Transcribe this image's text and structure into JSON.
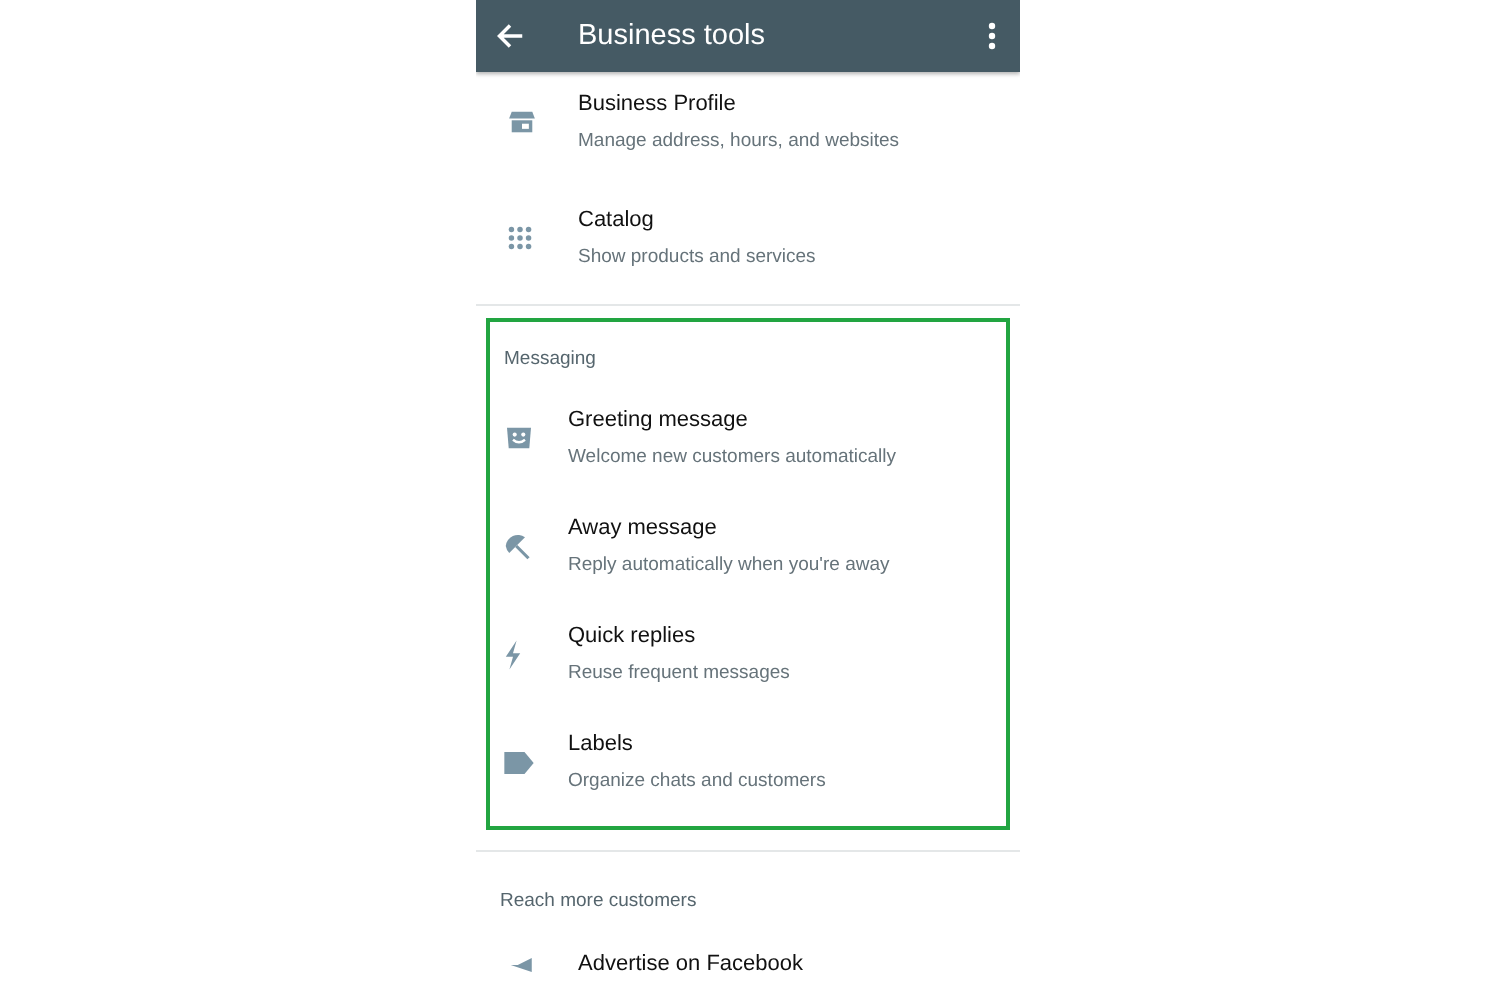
{
  "app_bar": {
    "title": "Business tools"
  },
  "sections": [
    {
      "highlighted": false,
      "items": [
        {
          "title": "Business Profile",
          "subtitle": "Manage address, hours, and websites"
        },
        {
          "title": "Catalog",
          "subtitle": "Show products and services"
        }
      ]
    },
    {
      "header": "Messaging",
      "highlighted": true,
      "items": [
        {
          "title": "Greeting message",
          "subtitle": "Welcome new customers automatically"
        },
        {
          "title": "Away message",
          "subtitle": "Reply automatically when you're away"
        },
        {
          "title": "Quick replies",
          "subtitle": "Reuse frequent messages"
        },
        {
          "title": "Labels",
          "subtitle": "Organize chats and customers"
        }
      ]
    },
    {
      "header": "Reach more customers",
      "highlighted": false,
      "items": [
        {
          "title": "Advertise on Facebook"
        }
      ]
    }
  ]
}
